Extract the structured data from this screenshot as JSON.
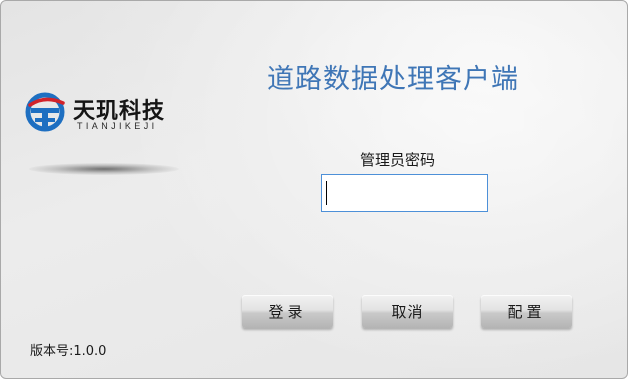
{
  "window": {
    "title": "道路数据处理客户端"
  },
  "logo": {
    "name": "天玑科技",
    "pinyin": "TIANJIKEJI",
    "icon": "tianji-logo-icon"
  },
  "login": {
    "password_label": "管理员密码",
    "password_value": "",
    "password_placeholder": ""
  },
  "buttons": {
    "login_label": "登录",
    "cancel_label": "取消",
    "config_label": "配置"
  },
  "footer": {
    "version_text": "版本号:1.0.0"
  },
  "colors": {
    "title_blue": "#3f76b6",
    "logo_blue": "#1e6fc1",
    "logo_red": "#d2232a",
    "input_border": "#4d90d8"
  }
}
